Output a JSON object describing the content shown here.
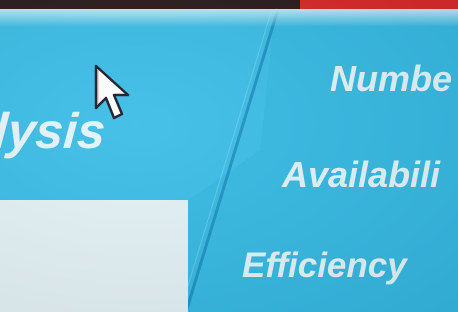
{
  "panel": {
    "heading_text": "lysis"
  },
  "fields": [
    {
      "label": "Numbe"
    },
    {
      "label": "Availabili"
    },
    {
      "label": "Efficiency"
    }
  ],
  "cursor": {
    "icon": "arrow-pointer-icon"
  },
  "colors": {
    "panel_blue": "#32b8e2",
    "left_blue": "#3bbde6",
    "divider_blue": "#1e93c4",
    "text_light": "#e3f5fb",
    "top_dark": "#2a1a1c",
    "top_red": "#d8282a",
    "white_box": "#e4f2f6"
  }
}
